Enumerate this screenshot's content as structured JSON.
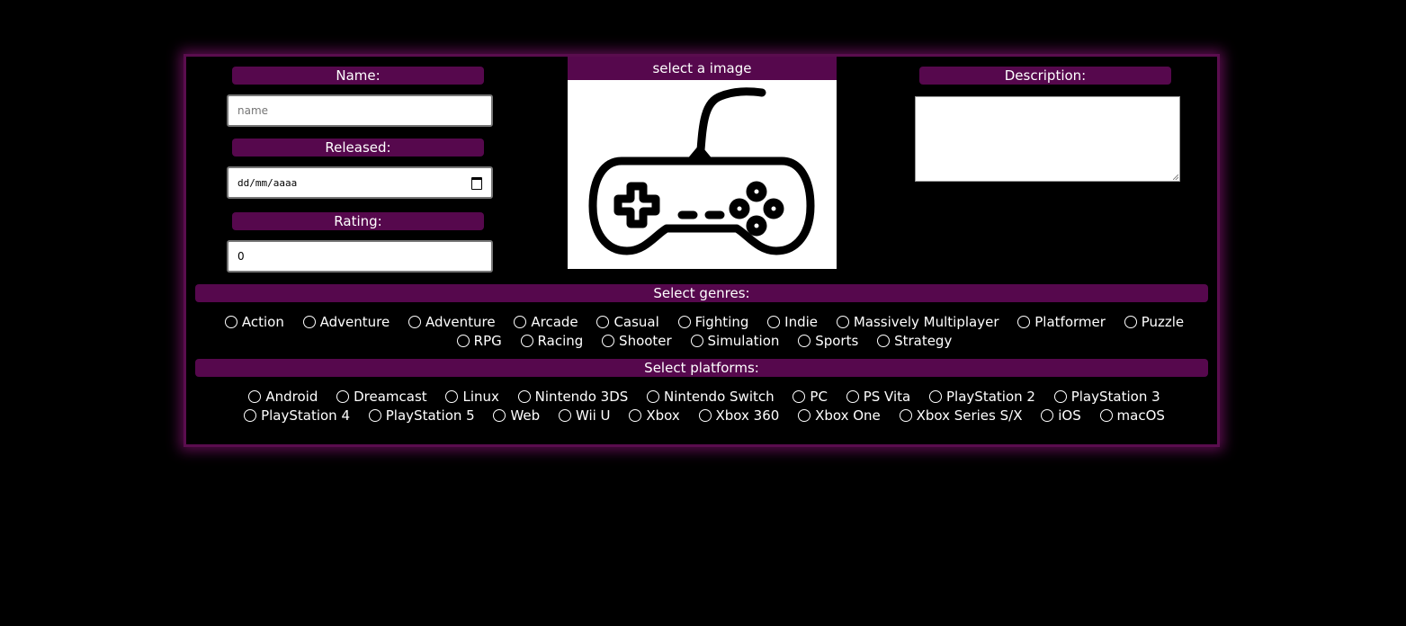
{
  "form": {
    "name_label": "Name:",
    "name_placeholder": "name",
    "released_label": "Released:",
    "released_value": "dd/mm/aaaa",
    "rating_label": "Rating:",
    "rating_value": "0",
    "image_label": "select a image",
    "description_label": "Description:",
    "description_value": ""
  },
  "genres": {
    "title": "Select genres:",
    "items": [
      "Action",
      "Adventure",
      "Adventure",
      "Arcade",
      "Casual",
      "Fighting",
      "Indie",
      "Massively Multiplayer",
      "Platformer",
      "Puzzle",
      "RPG",
      "Racing",
      "Shooter",
      "Simulation",
      "Sports",
      "Strategy"
    ]
  },
  "platforms": {
    "title": "Select platforms:",
    "items": [
      "Android",
      "Dreamcast",
      "Linux",
      "Nintendo 3DS",
      "Nintendo Switch",
      "PC",
      "PS Vita",
      "PlayStation 2",
      "PlayStation 3",
      "PlayStation 4",
      "PlayStation 5",
      "Web",
      "Wii U",
      "Xbox",
      "Xbox 360",
      "Xbox One",
      "Xbox Series S/X",
      "iOS",
      "macOS"
    ]
  },
  "colors": {
    "accent": "#56084d",
    "background": "#000000",
    "text": "#ffffff"
  },
  "icons": {
    "image": "gamepad-icon",
    "date_picker": "calendar-icon"
  }
}
